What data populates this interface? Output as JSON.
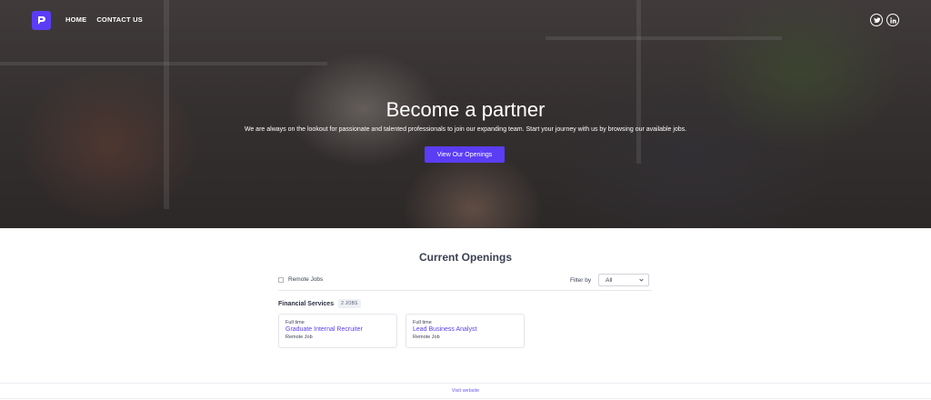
{
  "brand": {
    "accent": "#5b3df5"
  },
  "nav": {
    "items": [
      {
        "label": "HOME"
      },
      {
        "label": "CONTACT US"
      }
    ]
  },
  "social": [
    {
      "icon": "twitter-icon"
    },
    {
      "icon": "linkedin-icon"
    }
  ],
  "hero": {
    "title": "Become a partner",
    "subtitle": "We are always on the lookout for passionate and talented professionals to join our expanding team. Start your journey with us by browsing our available jobs.",
    "button_label": "View Our Openings"
  },
  "openings": {
    "title": "Current Openings",
    "remote_label": "Remote Jobs",
    "remote_checked": false,
    "filter_label": "Filter by",
    "filter_value": "All",
    "department": {
      "name": "Financial Services",
      "badge": "2 JOBS"
    },
    "jobs": [
      {
        "type": "Full time",
        "title": "Graduate Internal Recruiter",
        "location": "Remote Job"
      },
      {
        "type": "Full time",
        "title": "Lead Business Analyst",
        "location": "Remote Job"
      }
    ]
  },
  "footer": {
    "link_label": "Visit website"
  }
}
